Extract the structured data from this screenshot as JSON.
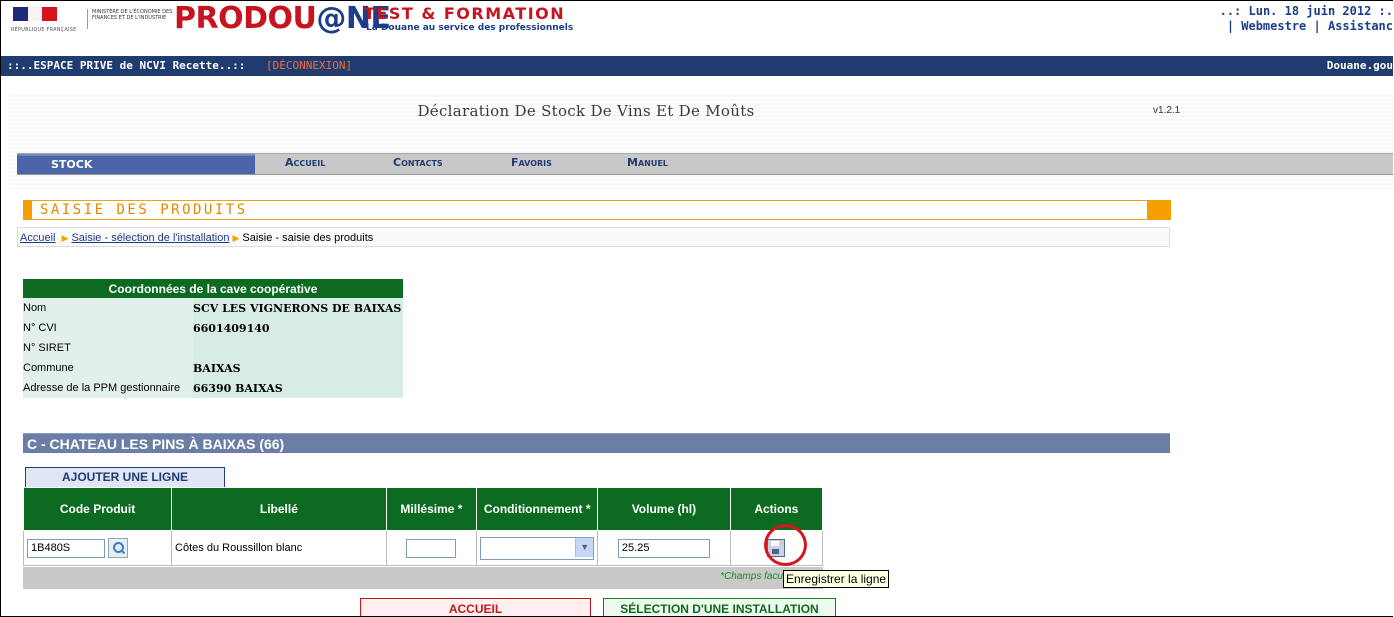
{
  "header": {
    "rf_text": "RÉPUBLIQUE FRANÇAISE",
    "ministry_text": "MINISTÈRE DE L'ÉCONOMIE DES FINANCES ET DE L'INDUSTRIE",
    "logo_pro": "PRODOU",
    "logo_at": "@",
    "logo_ne": "NE",
    "test_formation": "TEST & FORMATION",
    "tagline": "La Douane au service des professionnels",
    "date": "..: Lun. 18 juin 2012 :.",
    "webmestre": "| Webmestre |",
    "assistance": "Assistanc"
  },
  "bluebar": {
    "espace": "::..ESPACE PRIVE de NCVI Recette..::",
    "deconnexion": "[DÉCONNEXION]",
    "douane": "Douane.gou"
  },
  "page": {
    "title": "Déclaration De Stock De Vins Et De Moûts",
    "version": "v1.2.1"
  },
  "menu": {
    "stock": "STOCK",
    "accueil": "Accueil",
    "contacts": "Contacts",
    "favoris": "Favoris",
    "manuel": "Manuel"
  },
  "section": {
    "title": "SAISIE DES PRODUITS"
  },
  "breadcrumb": {
    "accueil": "Accueil",
    "selection": "Saisie - sélection de l'installation",
    "current": "Saisie - saisie des produits"
  },
  "coord": {
    "title": "Coordonnées de la cave coopérative",
    "rows": [
      {
        "label": "Nom",
        "value": "SCV LES VIGNERONS DE BAIXAS"
      },
      {
        "label": "N° CVI",
        "value": "6601409140"
      },
      {
        "label": "N° SIRET",
        "value": ""
      },
      {
        "label": "Commune",
        "value": "BAIXAS"
      },
      {
        "label": "Adresse de la PPM gestionnaire",
        "value": "66390 BAIXAS"
      }
    ]
  },
  "installation": {
    "title": "C - CHATEAU LES PINS À BAIXAS (66)"
  },
  "add_line": "AJOUTER UNE LIGNE",
  "table": {
    "headers": {
      "code": "Code Produit",
      "libelle": "Libellé",
      "millesime": "Millésime *",
      "conditionnement": "Conditionnement *",
      "volume": "Volume (hl)",
      "actions": "Actions"
    },
    "row": {
      "code": "1B480S",
      "libelle": "Côtes du Roussillon blanc",
      "millesime": "",
      "conditionnement": "",
      "volume": "25.25"
    },
    "note": "*Champs facu",
    "tooltip": "Enregistrer la ligne"
  },
  "buttons": {
    "accueil": "ACCUEIL",
    "selection": "SÉLECTION D'UNE INSTALLATION"
  },
  "colors": {
    "brand_red": "#c8141e",
    "brand_blue": "#1f3b6f",
    "accent_orange": "#f5a000",
    "table_green": "#0c6b20"
  }
}
